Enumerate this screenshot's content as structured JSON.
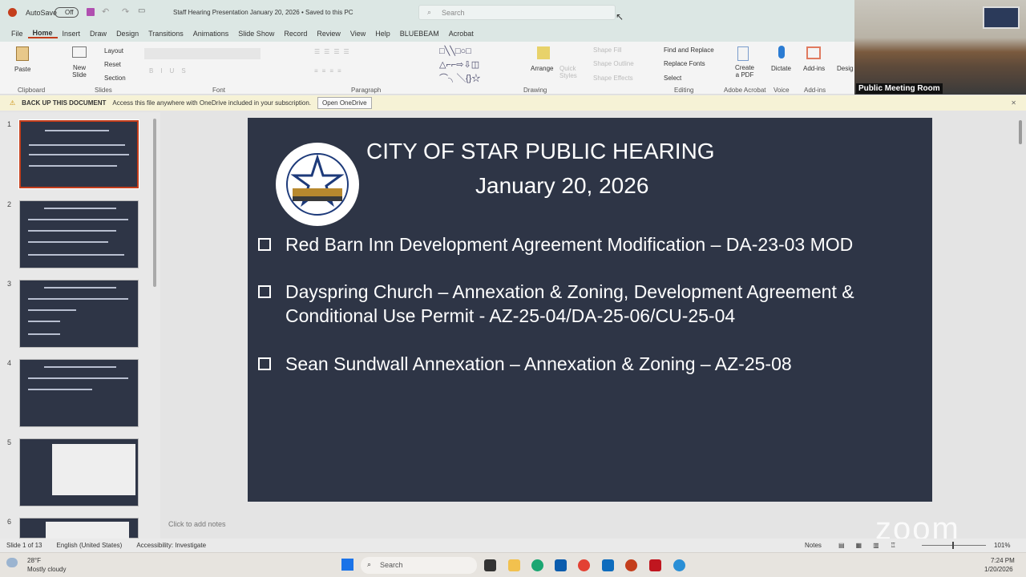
{
  "titlebar": {
    "autosave": "AutoSave",
    "autosave_state": "Off",
    "doc_title": "Staff Hearing Presentation January 20, 2026 • Saved to this PC",
    "search_placeholder": "Search"
  },
  "tabs": [
    "File",
    "Home",
    "Insert",
    "Draw",
    "Design",
    "Transitions",
    "Animations",
    "Slide Show",
    "Record",
    "Review",
    "View",
    "Help",
    "BLUEBEAM",
    "Acrobat"
  ],
  "ribbon": {
    "paste": "Paste",
    "new_slide": "New Slide",
    "layout": "Layout",
    "reset": "Reset",
    "section": "Section",
    "groups": {
      "clipboard": "Clipboard",
      "slides": "Slides",
      "font": "Font",
      "paragraph": "Paragraph",
      "drawing": "Drawing",
      "editing": "Editing",
      "acrobat": "Adobe Acrobat",
      "voice": "Voice",
      "addins": "Add-ins"
    },
    "arrange": "Arrange",
    "quick_styles": "Quick Styles",
    "shape_fill": "Shape Fill",
    "shape_outline": "Shape Outline",
    "shape_effects": "Shape Effects",
    "find_replace": "Find and Replace",
    "replace_fonts": "Replace Fonts",
    "select": "Select",
    "create_pdf": "Create a PDF",
    "dictate": "Dictate",
    "addins_btn": "Add-ins",
    "designer": "Designer"
  },
  "video": {
    "label": "Public Meeting Room"
  },
  "notification": {
    "title": "BACK UP THIS DOCUMENT",
    "message": "Access this file anywhere with OneDrive included in your subscription.",
    "button": "Open OneDrive"
  },
  "thumbnails": [
    "1",
    "2",
    "3",
    "4",
    "5",
    "6"
  ],
  "slide": {
    "title": "CITY OF STAR PUBLIC HEARING",
    "date": "January 20, 2026",
    "seal": "THE SEAL OF THE CITY OF STAR IDAHO",
    "bullets": [
      "Red Barn Inn Development Agreement Modification – DA-23-03 MOD",
      "Dayspring Church – Annexation & Zoning, Development Agreement & Conditional Use Permit - AZ-25-04/DA-25-06/CU-25-04",
      "Sean Sundwall Annexation – Annexation & Zoning – AZ-25-08"
    ]
  },
  "notes_placeholder": "Click to add notes",
  "status": {
    "slide": "Slide 1 of 13",
    "language": "English (United States)",
    "accessibility": "Accessibility: Investigate",
    "notes": "Notes",
    "zoom": "101%"
  },
  "taskbar": {
    "weather_temp": "28°F",
    "weather_desc": "Mostly cloudy",
    "search": "Search",
    "time": "7:24 PM",
    "date": "1/20/2026"
  },
  "watermark": "zoom"
}
